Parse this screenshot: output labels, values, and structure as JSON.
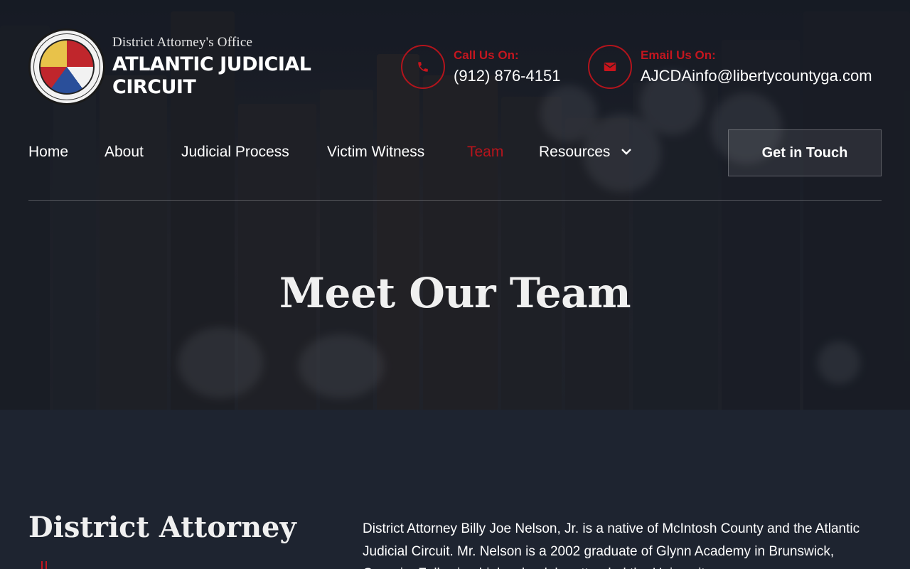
{
  "header": {
    "brand_sub": "District Attorney's Office",
    "brand_title": "ATLANTIC JUDICIAL CIRCUIT",
    "phone_label": "Call Us On:",
    "phone_value": "(912) 876-4151",
    "email_label": "Email Us On:",
    "email_value": "AJCDAinfo@libertycountyga.com"
  },
  "nav": {
    "items": [
      {
        "label": "Home"
      },
      {
        "label": "About"
      },
      {
        "label": "Judicial Process"
      },
      {
        "label": "Victim Witness"
      },
      {
        "label": "Team",
        "active": true
      },
      {
        "label": "Resources",
        "has_dropdown": true
      }
    ],
    "cta_label": "Get in Touch"
  },
  "hero": {
    "title": "Meet Our Team"
  },
  "section": {
    "title": "District Attorney",
    "bio": "District Attorney Billy Joe Nelson, Jr. is a native of McIntosh County and the Atlantic Judicial Circuit. Mr. Nelson is a 2002 graduate of Glynn Academy in Brunswick, Georgia. Following high school, he attended the University..."
  },
  "colors": {
    "accent": "#c4161f",
    "background": "#1e2430"
  },
  "icons": {
    "phone": "phone-icon",
    "email": "email-icon",
    "chevron": "chevron-down-icon"
  }
}
